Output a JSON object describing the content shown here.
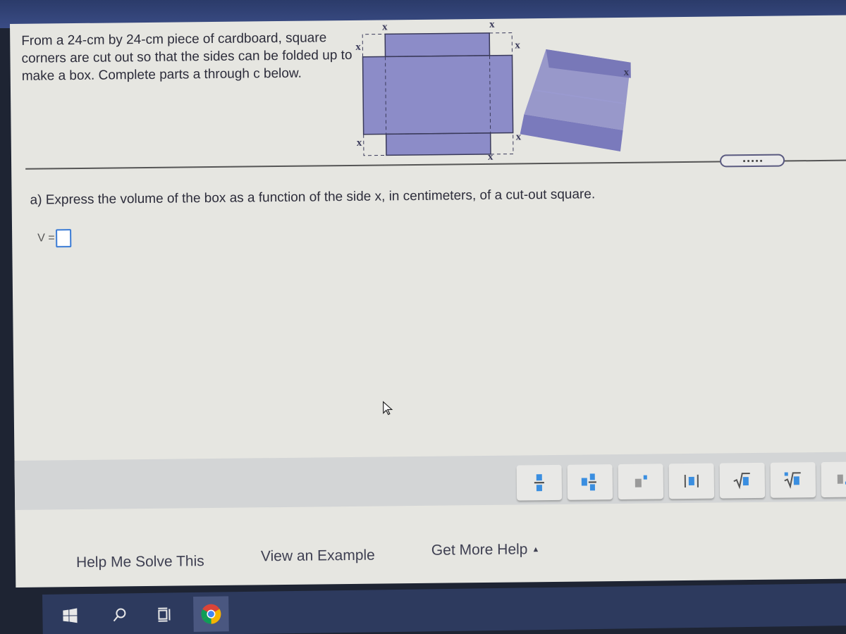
{
  "problem": {
    "intro": "From a 24-cm by 24-cm piece of cardboard, square corners are cut out so that the sides can be folded up to make a box. Complete parts a through c below.",
    "diagram_label": "x",
    "colors": {
      "cardboard": "#8c8cc8",
      "box": "#8a8ac6",
      "dashed_outline": "#3a3a5a"
    }
  },
  "expand_handle": {
    "icon": "ellipsis-icon"
  },
  "part_a": {
    "question": "a) Express the volume of the box as a function of the side x, in centimeters, of a cut-out square.",
    "answer_label": "V =",
    "answer_value": ""
  },
  "math_toolbar": {
    "buttons": [
      {
        "name": "fraction",
        "icon": "fraction-icon"
      },
      {
        "name": "mixed-number",
        "icon": "mixed-number-icon"
      },
      {
        "name": "exponent",
        "icon": "exponent-icon"
      },
      {
        "name": "absolute-value",
        "icon": "absolute-value-icon"
      },
      {
        "name": "square-root",
        "icon": "square-root-icon"
      },
      {
        "name": "nth-root",
        "icon": "nth-root-icon"
      },
      {
        "name": "decimal",
        "icon": "decimal-icon"
      }
    ],
    "accent": "#3a8ee0"
  },
  "help": {
    "help_me_solve": "Help Me Solve This",
    "view_example": "View an Example",
    "get_more_help": "Get More Help",
    "get_more_help_caret": "▲"
  },
  "taskbar": {
    "items": [
      {
        "name": "start",
        "icon": "windows-icon"
      },
      {
        "name": "search",
        "icon": "search-icon"
      },
      {
        "name": "task-view",
        "icon": "task-view-icon"
      },
      {
        "name": "chrome",
        "icon": "chrome-icon"
      }
    ]
  }
}
